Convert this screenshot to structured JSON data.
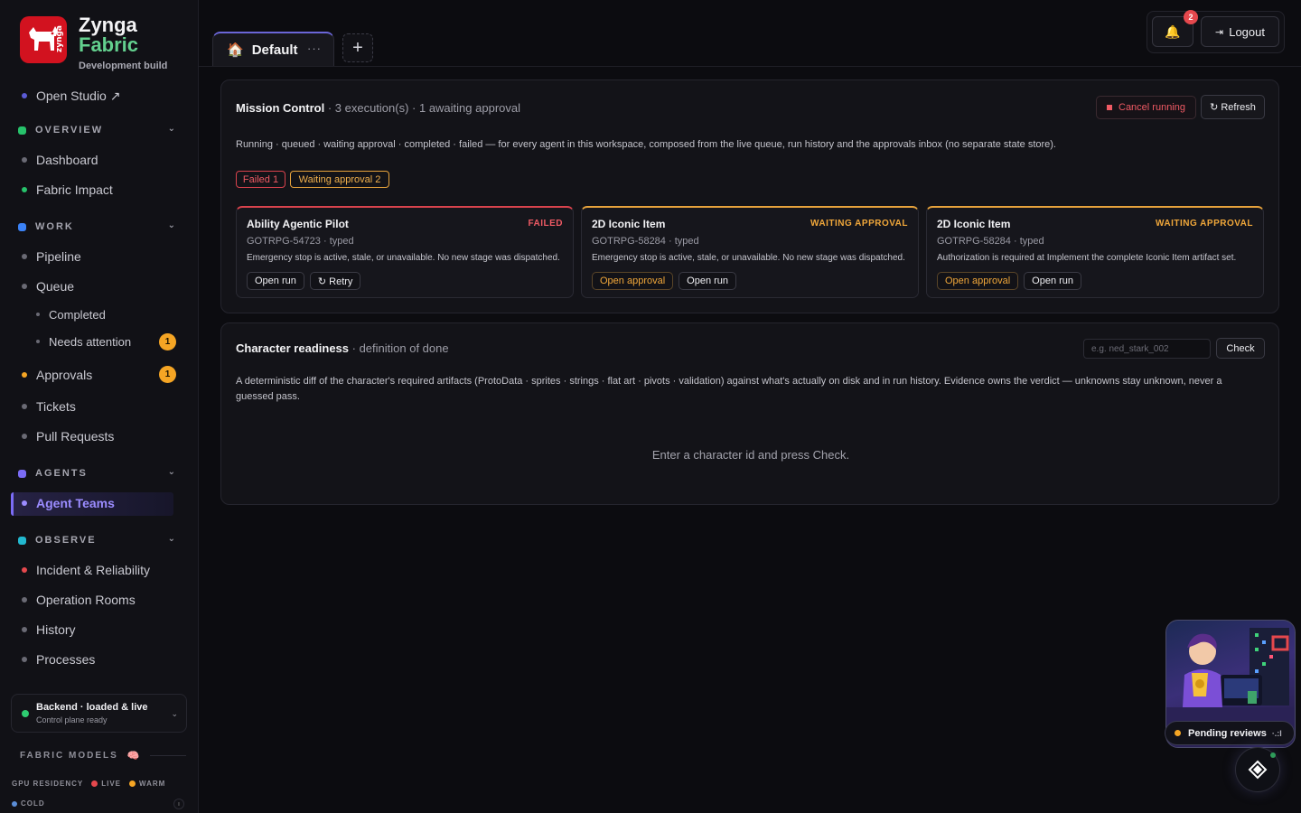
{
  "brand": {
    "name_line1": "Zynga",
    "name_line2": "Fabric",
    "subtitle": "Development build",
    "logo_side_text": "zynga"
  },
  "sidebar": {
    "open_studio": "Open Studio ↗",
    "sections": {
      "overview": "OVERVIEW",
      "work": "WORK",
      "agents": "AGENTS",
      "observe": "OBSERVE"
    },
    "items": {
      "dashboard": "Dashboard",
      "fabric_impact": "Fabric Impact",
      "pipeline": "Pipeline",
      "queue": "Queue",
      "completed": "Completed",
      "needs_attention": "Needs attention",
      "needs_attention_count": "1",
      "approvals": "Approvals",
      "approvals_count": "1",
      "tickets": "Tickets",
      "pull_requests": "Pull Requests",
      "agent_teams": "Agent Teams",
      "incident": "Incident & Reliability",
      "operation_rooms": "Operation Rooms",
      "history": "History",
      "processes": "Processes"
    },
    "backend": {
      "status": "Backend · loaded & live",
      "detail": "Control plane ready"
    },
    "fabric_models": "FABRIC MODELS",
    "gpu_residency": "GPU RESIDENCY",
    "legend": {
      "live": "LIVE",
      "warm": "WARM",
      "cold": "COLD"
    }
  },
  "tabs": {
    "active": "Default",
    "more": "···",
    "add": "+"
  },
  "header": {
    "notification_count": "2",
    "logout": "Logout"
  },
  "mission_control": {
    "title": "Mission Control",
    "summary": " · 3 execution(s) · 1 awaiting approval",
    "cancel": "Cancel running",
    "refresh": "↻ Refresh",
    "description": "Running · queued · waiting approval · completed · failed — for every agent in this workspace, composed from the live queue, run history and the approvals inbox (no separate state store).",
    "pill_failed": "Failed 1",
    "pill_waiting": "Waiting approval 2",
    "cards": [
      {
        "title": "Ability Agentic Pilot",
        "status": "FAILED",
        "id": "GOTRPG-54723 · typed",
        "message": "Emergency stop is active, stale, or unavailable. No new stage was dispatched.",
        "btn1": "Open run",
        "btn2": "↻ Retry"
      },
      {
        "title": "2D Iconic Item",
        "status": "WAITING APPROVAL",
        "id": "GOTRPG-58284 · typed",
        "message": "Emergency stop is active, stale, or unavailable. No new stage was dispatched.",
        "btn1": "Open approval",
        "btn2": "Open run"
      },
      {
        "title": "2D Iconic Item",
        "status": "WAITING APPROVAL",
        "id": "GOTRPG-58284 · typed",
        "message": "Authorization is required at Implement the complete Iconic Item artifact set.",
        "btn1": "Open approval",
        "btn2": "Open run"
      }
    ]
  },
  "readiness": {
    "title": "Character readiness",
    "subtitle": " · definition of done",
    "placeholder": "e.g. ned_stark_002",
    "check": "Check",
    "description": "A deterministic diff of the character's required artifacts (ProtoData · sprites · strings · flat art · pivots · validation) against what's actually on disk and in run history. Evidence owns the verdict — unknowns stay unknown, never a guessed pass.",
    "empty": "Enter a character id and press Check."
  },
  "floating": {
    "pending_reviews": "Pending reviews",
    "pending_bars": "·.:l"
  },
  "colors": {
    "accent": "#7b6cf6",
    "brand_red": "#d2121f",
    "brand_green": "#63d08e",
    "failed": "#ef5a64",
    "waiting": "#f0a73a"
  },
  "icons": {
    "bell": "bell-icon",
    "logout": "logout-icon",
    "house": "house-icon",
    "fab": "diamond-icon"
  }
}
